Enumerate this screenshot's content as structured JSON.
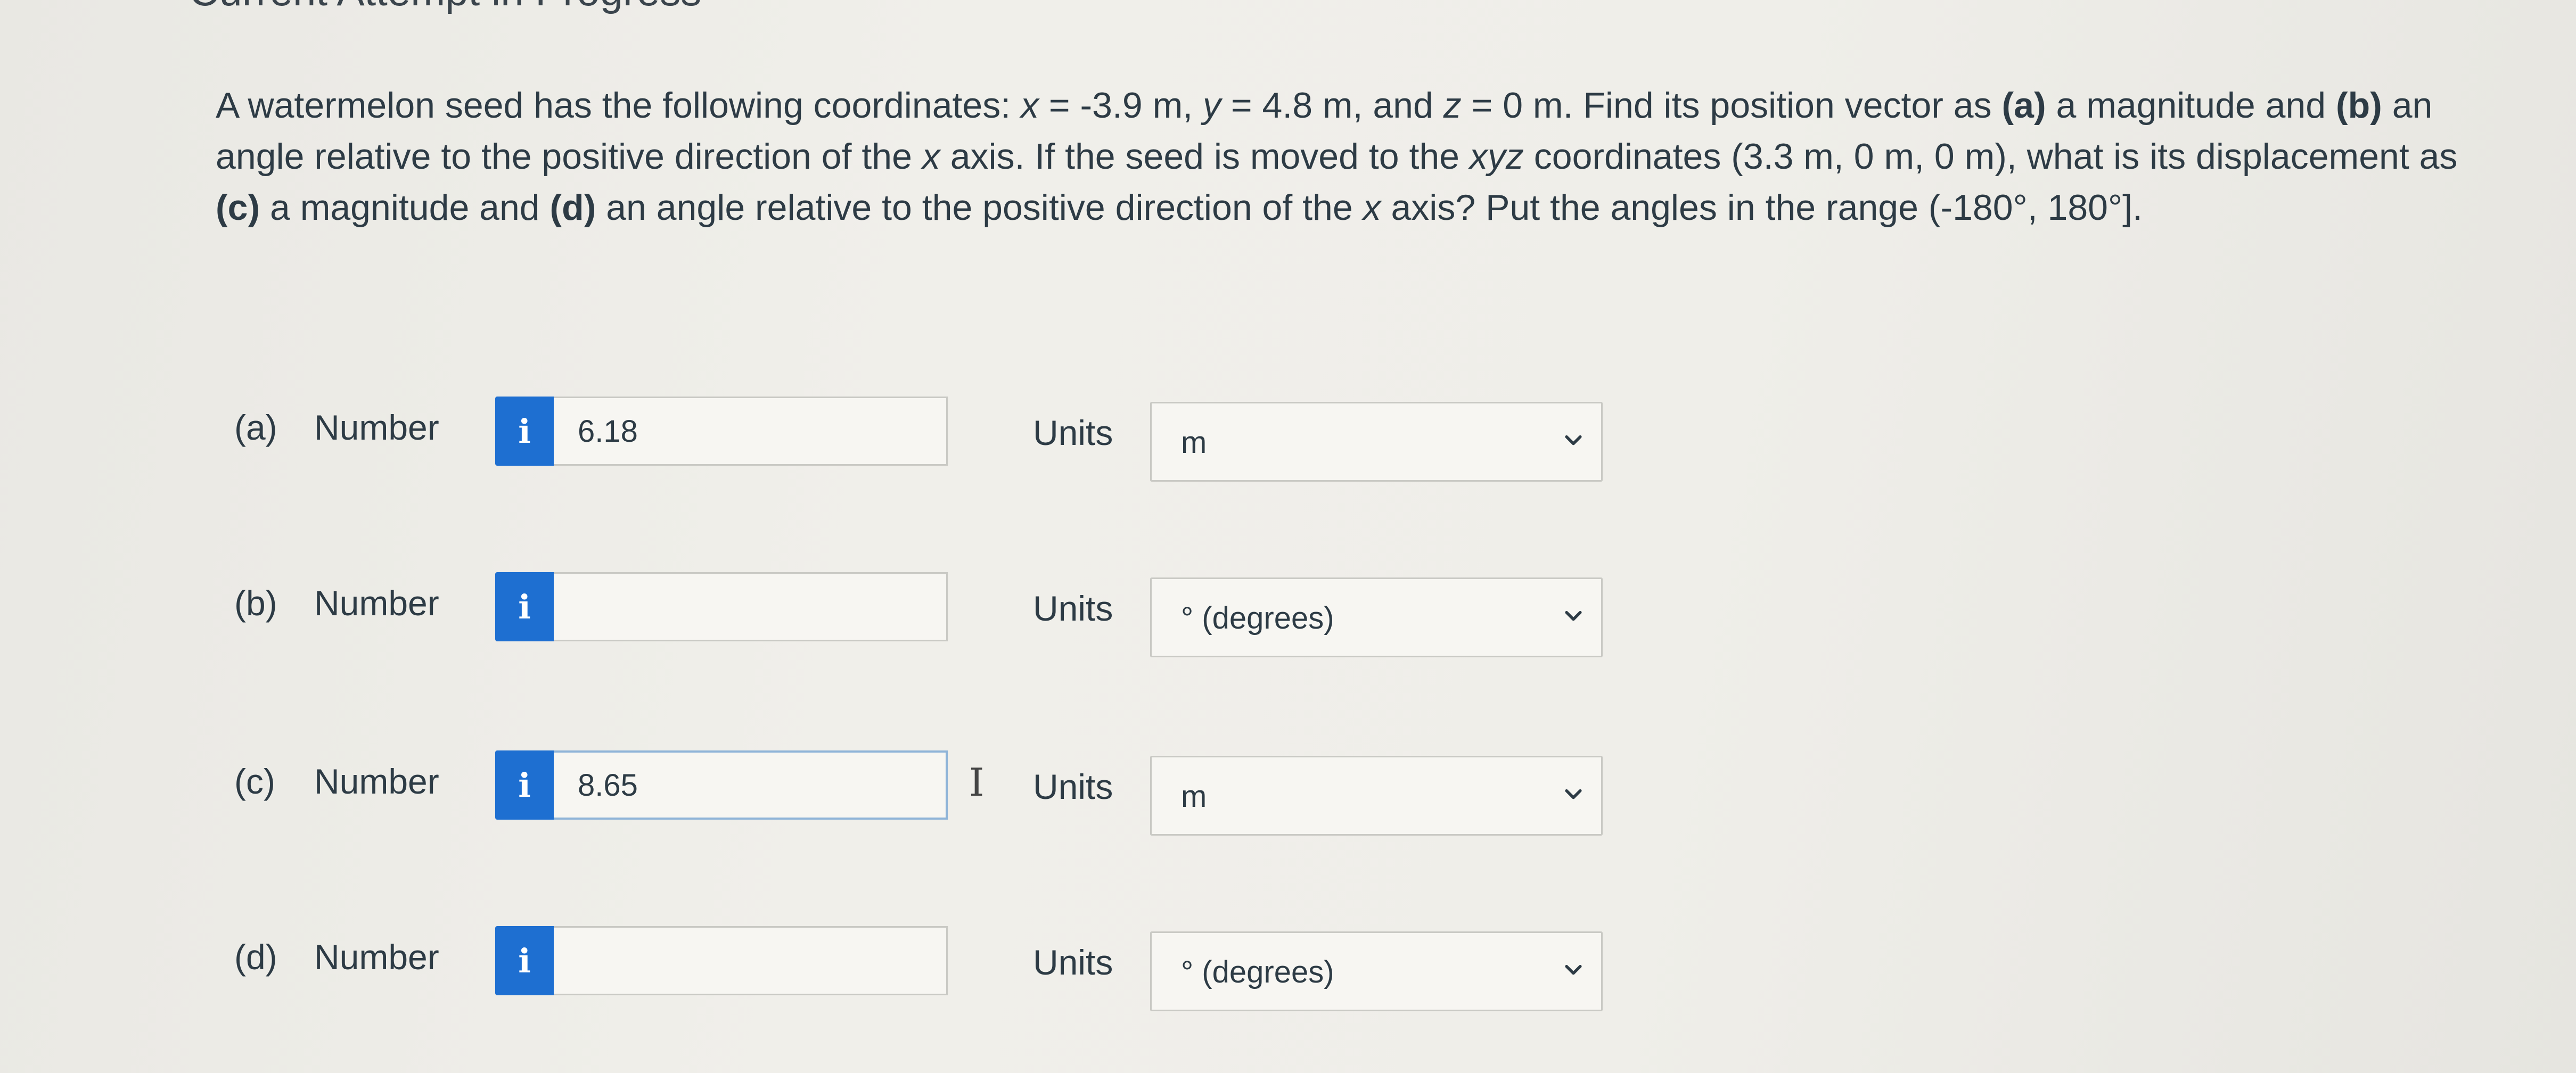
{
  "header": {
    "title_fragment": "Current Attempt in Progress"
  },
  "question": {
    "segments": [
      {
        "text": "A watermelon seed has the following coordinates: "
      },
      {
        "text": "x",
        "style": "ital"
      },
      {
        "text": " = -3.9 m, "
      },
      {
        "text": "y",
        "style": "ital"
      },
      {
        "text": " = 4.8 m, and "
      },
      {
        "text": "z",
        "style": "ital"
      },
      {
        "text": " = 0 m. Find its position vector as "
      },
      {
        "text": "(a)",
        "style": "bold"
      },
      {
        "text": " a magnitude and "
      },
      {
        "text": "(b)",
        "style": "bold"
      },
      {
        "text": " an angle relative to the positive direction of the "
      },
      {
        "text": "x",
        "style": "ital"
      },
      {
        "text": " axis. If the seed is moved to the "
      },
      {
        "text": "xyz",
        "style": "ital"
      },
      {
        "text": " coordinates (3.3 m, 0 m, 0 m), what is its displacement as "
      },
      {
        "text": "(c)",
        "style": "bold"
      },
      {
        "text": " a magnitude and "
      },
      {
        "text": "(d)",
        "style": "bold"
      },
      {
        "text": " an angle relative to the positive direction of the "
      },
      {
        "text": "x",
        "style": "ital"
      },
      {
        "text": " axis? Put the angles in the range (-180°, 180°]."
      }
    ]
  },
  "answers": {
    "number_label": "Number",
    "units_label": "Units",
    "info_icon_glyph": "i",
    "cursor_glyph": "I",
    "parts": [
      {
        "part_label": "(a)",
        "value": "6.18",
        "unit": "m"
      },
      {
        "part_label": "(b)",
        "value": "",
        "unit": "° (degrees)"
      },
      {
        "part_label": "(c)",
        "value": "8.65",
        "unit": "m"
      },
      {
        "part_label": "(d)",
        "value": "",
        "unit": "° (degrees)"
      }
    ]
  },
  "colors": {
    "info_button": "#1e6fd1",
    "text": "#2d3b45",
    "focus_border": "#8fb4d8"
  }
}
